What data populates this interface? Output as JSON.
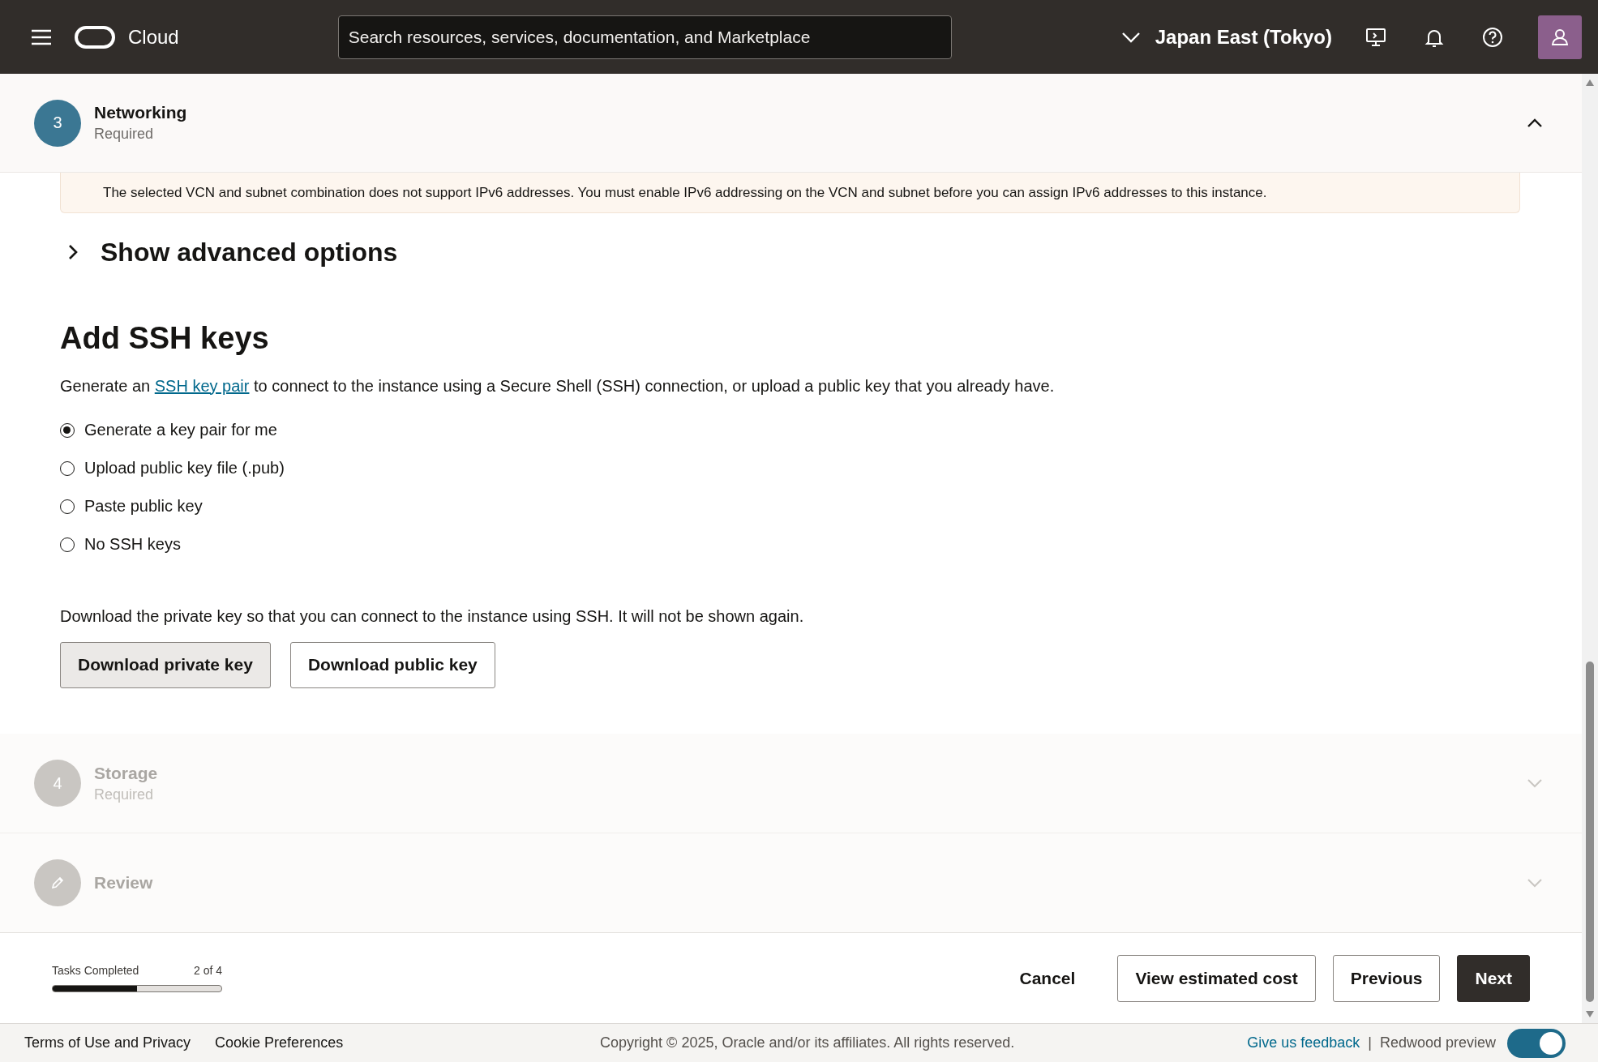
{
  "header": {
    "brand": "Cloud",
    "search": {
      "placeholder": "Search resources, services, documentation, and Marketplace"
    },
    "region": "Japan East (Tokyo)"
  },
  "current_step": {
    "badge": "3",
    "title": "Networking",
    "subtitle": "Required",
    "expanded": true,
    "disabled": false
  },
  "alert": {
    "text": "The selected VCN and subnet combination does not support IPv6 addresses. You must enable IPv6 addressing on the VCN and subnet before you can assign IPv6 addresses to this instance."
  },
  "advanced": {
    "label": "Show advanced options",
    "expanded": false
  },
  "ssh": {
    "heading": "Add SSH keys",
    "intro_before": "Generate an",
    "intro_link": "SSH key pair",
    "intro_after": "to connect to the instance using a Secure Shell (SSH) connection, or upload a public key that you already have.",
    "options": [
      {
        "label": "Generate a key pair for me",
        "selected": true
      },
      {
        "label": "Upload public key file (.pub)",
        "selected": false
      },
      {
        "label": "Paste public key",
        "selected": false
      },
      {
        "label": "No SSH keys",
        "selected": false
      }
    ],
    "download_note": "Download the private key so that you can connect to the instance using SSH. It will not be shown again.",
    "buttons": [
      {
        "label": "Download private key",
        "pressed": true
      },
      {
        "label": "Download public key",
        "pressed": false
      }
    ]
  },
  "next_steps": [
    {
      "kind": "number",
      "badge": "4",
      "title": "Storage",
      "subtitle": "Required",
      "expanded": false,
      "disabled": true
    },
    {
      "kind": "edit",
      "title": "Review",
      "expanded": false,
      "disabled": true
    }
  ],
  "progress": {
    "label": "Tasks Completed",
    "count": "2 of 4",
    "level": 0.5
  },
  "actions": [
    {
      "kind": "link",
      "label": "Cancel"
    },
    {
      "kind": "outline",
      "label": "View estimated cost"
    },
    {
      "kind": "outline",
      "label": "Previous"
    },
    {
      "kind": "primary",
      "label": "Next"
    }
  ],
  "footer": {
    "links": [
      "Terms of Use and Privacy",
      "Cookie Preferences"
    ],
    "copyright": "Copyright © 2025, Oracle and/or its affiliates. All rights reserved.",
    "feedback": "Give us feedback",
    "separator": "|",
    "preview_label": "Redwood preview",
    "preview_on": true
  }
}
